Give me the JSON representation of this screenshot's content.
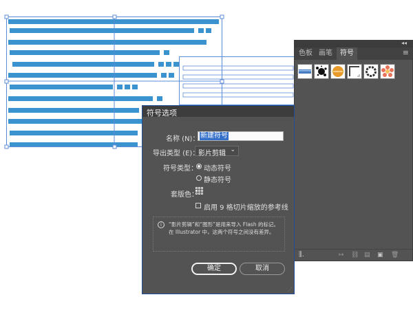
{
  "canvas": {
    "bar_color": "#3a92cf",
    "selection_color": "#5b8bd8"
  },
  "symbols_panel": {
    "tabs": [
      "色板",
      "画笔",
      "符号"
    ],
    "active_tab": "符号",
    "menu_icon": "hamburger-menu-icon",
    "collapse_icon": "double-chevron-icon",
    "symbols": [
      {
        "name": "blue-banner-symbol",
        "color": "#4a7cc2"
      },
      {
        "name": "ink-splatter-symbol",
        "color": "#111111"
      },
      {
        "name": "orange-button-symbol",
        "color": "#e89a2a"
      },
      {
        "name": "frame-corner-symbol",
        "color": "#444444"
      },
      {
        "name": "ring-symbol",
        "color": "#333333"
      },
      {
        "name": "flower-symbol",
        "color": "#e8735a"
      }
    ],
    "footer_icons": [
      "symbol-libraries-icon",
      "place-symbol-icon",
      "break-link-icon",
      "symbol-options-icon",
      "new-symbol-icon",
      "delete-icon"
    ]
  },
  "dialog": {
    "title": "符号选项",
    "name_label": "名称 (N)：",
    "name_value": "新建符号",
    "export_type_label": "导出类型 (E)：",
    "export_type_value": "影片剪辑",
    "symbol_type_label": "符号类型：",
    "symbol_type_dynamic": "动态符号",
    "symbol_type_static": "静态符号",
    "symbol_type_selected": "dynamic",
    "registration_label": "套版色：",
    "nine_slice_label": "启用 9 格切片缩放的参考线",
    "nine_slice_checked": false,
    "info_text": "“影片剪辑”和“图形”是用来导入 Flash 的标记。在 Illustrator 中，这两个符号之间没有差异。",
    "ok_label": "确定",
    "cancel_label": "取消"
  }
}
